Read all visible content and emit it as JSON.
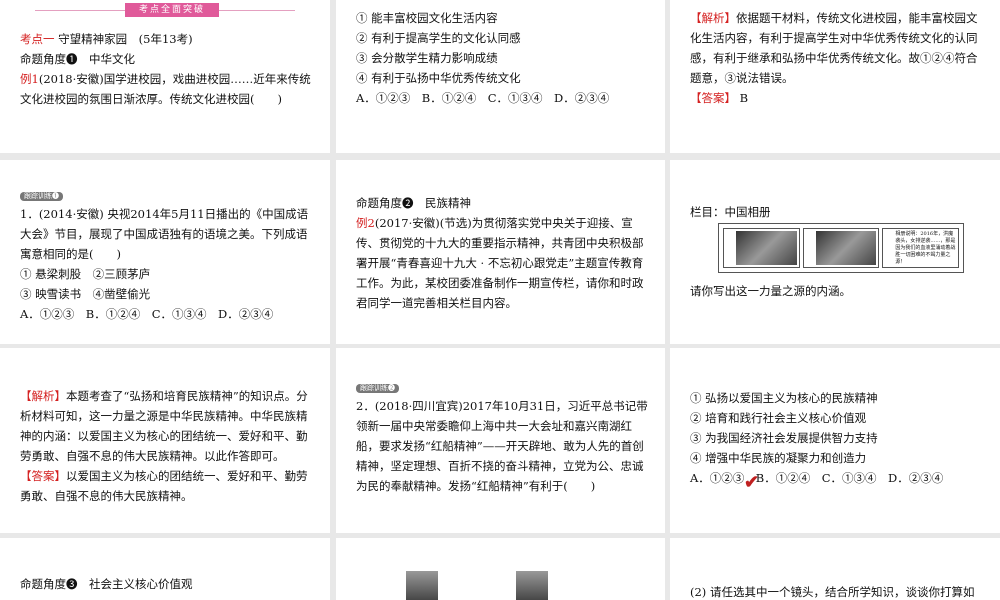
{
  "slide1": {
    "banner": "考点全面突破",
    "kaodian_label": "考点一",
    "kaodian_title": "守望精神家园　(5年13考)",
    "angle": "命题角度❶　中华文化",
    "example_label": "例1",
    "example_text": "(2018·安徽)国学进校园，戏曲进校园……近年来传统文化进校园的氛围日渐浓厚。传统文化进校园(　　)"
  },
  "slide2": {
    "options": [
      "① 能丰富校园文化生活内容",
      "② 有利于提高学生的文化认同感",
      "③ 会分散学生精力影响成绩",
      "④ 有利于弘扬中华优秀传统文化"
    ],
    "choices": "A．①②③　B．①②④　C．①③④　D．②③④"
  },
  "slide3": {
    "analysis_label": "【解析】",
    "analysis": "依据题干材料，传统文化进校园，能丰富校园文化生活内容，有利于提高学生对中华优秀传统文化的认同感，有利于继承和弘扬中华优秀传统文化。故①②④符合题意，③说法错误。",
    "answer_label": "【答案】",
    "answer": "B"
  },
  "slide4": {
    "tag": "跟踪训练❶",
    "q_line1": "1．(2014·安徽) 央视2014年5月11日播出的《中国成语",
    "q_line2": "大会》节目，展现了中国成语独有的语境之美。下列成语寓意相同的是(　　)",
    "opt1": "① 悬梁刺股　②三顾茅庐",
    "opt2": "③ 映雪读书　④凿壁偷光",
    "choices": "A．①②③　B．①②④　C．①③④　D．②③④"
  },
  "slide5": {
    "angle": "命题角度❷　民族精神",
    "example_label": "例2",
    "example_text": "(2017·安徽)(节选)为贯彻落实党中央关于迎接、宣传、贯彻党的十九大的重要指示精神，共青团中央积极部署开展“青春喜迎十九大 · 不忘初心跟党走”主题宣传教育工作。为此，某校团委准备制作一期宣传栏，请你和时政君同学一道完善相关栏目内容。"
  },
  "slide6": {
    "column": "栏目：中国相册",
    "photo_caption": "相册说明：2016年，洪魔袭头，女排逆袭……，那是因为我们的血液里涌动着战胜一切困难的不竭力量之源！",
    "question": "请你写出这一力量之源的内涵。"
  },
  "slide7": {
    "analysis_label": "【解析】",
    "analysis": "本题考查了“弘扬和培育民族精神”的知识点。分析材料可知，这一力量之源是中华民族精神。中华民族精神的内涵：以爱国主义为核心的团结统一、爱好和平、勤劳勇敢、自强不息的伟大民族精神。以此作答即可。",
    "answer_label": "【答案】",
    "answer": "以爱国主义为核心的团结统一、爱好和平、勤劳勇敢、自强不息的伟大民族精神。"
  },
  "slide8": {
    "tag": "跟踪训练❷",
    "question": "2．(2018·四川宜宾)2017年10月31日，习近平总书记带领新一届中央常委瞻仰上海中共一大会址和嘉兴南湖红船，要求发扬“红船精神”——开天辟地、敢为人先的首创精神，坚定理想、百折不挠的奋斗精神，立党为公、忠诚为民的奉献精神。发扬“红船精神”有利于(　　)"
  },
  "slide9": {
    "options": [
      "① 弘扬以爱国主义为核心的民族精神",
      "② 培育和践行社会主义核心价值观",
      "③ 为我国经济社会发展提供智力支持",
      "④ 增强中华民族的凝聚力和创造力"
    ],
    "choices": "A．①②③　B．①②④　C．①③④　D．②③④"
  },
  "slide10": {
    "angle": "命题角度❸　社会主义核心价值观"
  },
  "slide12": {
    "question": "(2) 请任选其中一个镜头，结合所学知识，谈谈你打算如"
  }
}
